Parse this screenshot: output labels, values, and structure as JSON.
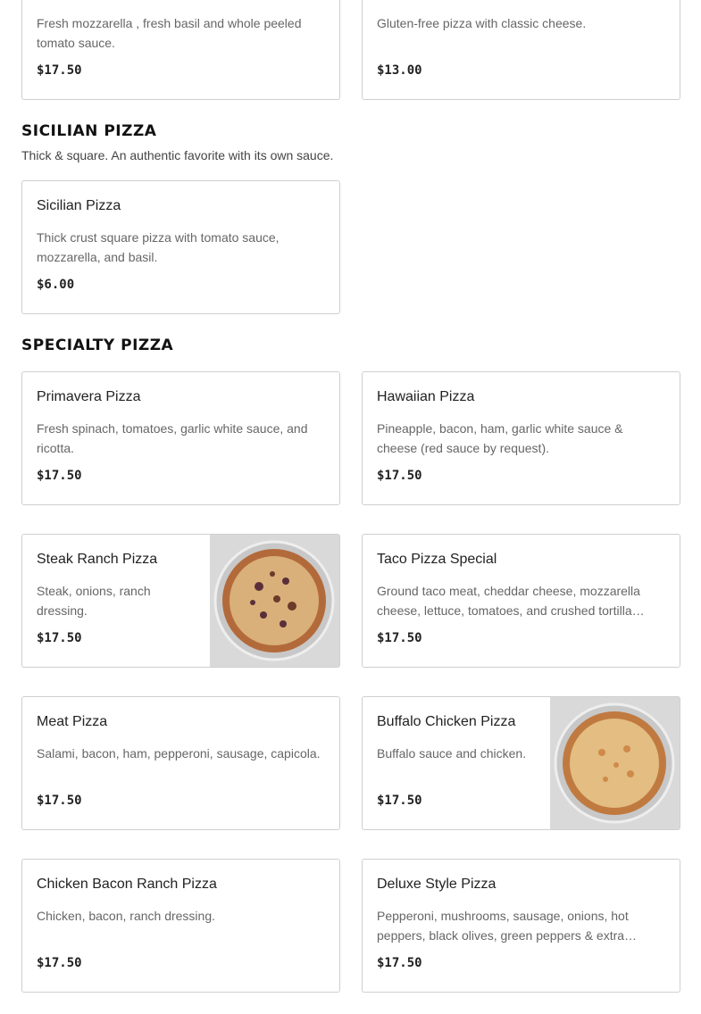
{
  "top_cards": [
    {
      "desc": "Fresh mozzarella , fresh basil and whole peeled tomato sauce.",
      "price": "$17.50"
    },
    {
      "desc": "Gluten-free pizza with classic cheese.",
      "price": "$13.00"
    }
  ],
  "sicilian": {
    "title": "SICILIAN PIZZA",
    "subtitle": "Thick & square. An authentic favorite with its own sauce.",
    "items": [
      {
        "name": "Sicilian Pizza",
        "desc": "Thick crust square pizza with tomato sauce, mozzarella, and basil.",
        "price": "$6.00"
      }
    ]
  },
  "specialty": {
    "title": "SPECIALTY PIZZA",
    "items": [
      {
        "name": "Primavera Pizza",
        "desc": "Fresh spinach, tomatoes, garlic white sauce, and ricotta.",
        "price": "$17.50"
      },
      {
        "name": "Hawaiian Pizza",
        "desc": "Pineapple, bacon, ham, garlic white sauce & cheese (red sauce by request).",
        "price": "$17.50"
      },
      {
        "name": "Steak Ranch Pizza",
        "desc": "Steak, onions, ranch dressing.",
        "price": "$17.50"
      },
      {
        "name": "Taco Pizza Special",
        "desc": "Ground taco meat, cheddar cheese, mozzarella cheese, lettuce, tomatoes, and crushed tortilla chips.",
        "price": "$17.50"
      },
      {
        "name": "Meat Pizza",
        "desc": "Salami, bacon, ham, pepperoni, sausage, capicola.",
        "price": "$17.50"
      },
      {
        "name": "Buffalo Chicken Pizza",
        "desc": "Buffalo sauce and chicken.",
        "price": "$17.50"
      },
      {
        "name": "Chicken Bacon Ranch Pizza",
        "desc": "Chicken, bacon, ranch dressing.",
        "price": "$17.50"
      },
      {
        "name": "Deluxe Style Pizza",
        "desc": "Pepperoni, mushrooms, sausage, onions, hot peppers, black olives, green peppers & extra cheese.",
        "price": "$17.50"
      }
    ]
  }
}
